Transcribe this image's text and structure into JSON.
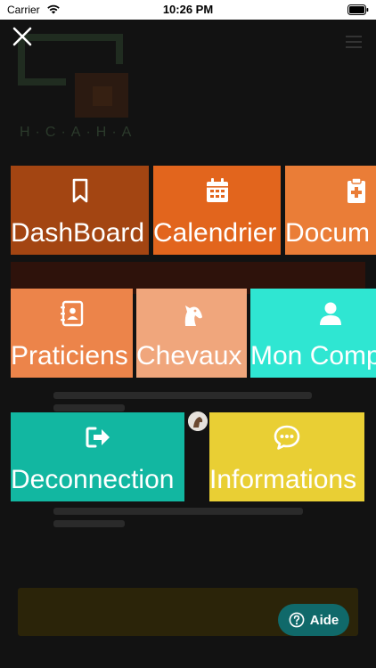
{
  "status_bar": {
    "carrier": "Carrier",
    "time": "10:26 PM"
  },
  "menu": {
    "tiles": [
      {
        "label": "DashBoard",
        "icon": "bookmark-icon",
        "color": "#a34512"
      },
      {
        "label": "Calendrier",
        "icon": "calendar-icon",
        "color": "#e2651d"
      },
      {
        "label": "Docum",
        "icon": "clipboard-medical-icon",
        "color": "#ea7d37"
      },
      {
        "label": "Praticiens",
        "icon": "address-book-icon",
        "color": "#ec844a"
      },
      {
        "label": "Chevaux",
        "icon": "horse-head-icon",
        "color": "#f0a67c"
      },
      {
        "label": "Mon Comp",
        "icon": "user-icon",
        "color": "#2fe6d2"
      },
      {
        "label": "Deconnection",
        "icon": "sign-out-icon",
        "color": "#12b7a1"
      },
      {
        "label": "Informations",
        "icon": "comment-dots-icon",
        "color": "#e9cf34"
      }
    ]
  },
  "aide_button": {
    "label": "Aide",
    "color": "#10696a"
  }
}
